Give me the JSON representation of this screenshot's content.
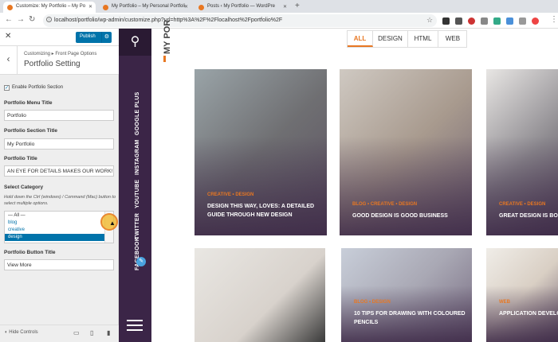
{
  "browser": {
    "tabs": [
      {
        "title": "Customize: My Portfolio – My Po"
      },
      {
        "title": "My Portfolio – My Personal Portfoli"
      },
      {
        "title": "Posts ‹ My Portfolio — WordPre"
      }
    ],
    "url": "localhost/portfolio/wp-admin/customize.php?url=http%3A%2F%2Flocalhost%2Fportfolio%2F"
  },
  "customizer": {
    "publish": "Publish",
    "breadcrumb": "Customizing ▸ Front Page Options",
    "title": "Portfolio Setting",
    "enable_label": "Enable Portfolio Section",
    "menu_title_label": "Portfolio Menu Title",
    "menu_title_value": "Portfolio",
    "section_title_label": "Portfolio Section Title",
    "section_title_value": "My Portfolio",
    "title_label": "Portfolio Title",
    "title_value": "AN EYE FOR DETAILS MAKES OUR WORK!",
    "category_label": "Select Category",
    "category_desc": "Hold down the Ctrl (windows) / Command (Mac) button to select multiple options.",
    "category_options": [
      "— All —",
      "blog",
      "creative",
      "design"
    ],
    "category_selected": "design",
    "button_title_label": "Portfolio Button Title",
    "button_title_value": "View More",
    "hide_controls": "Hide Controls"
  },
  "site": {
    "social": [
      "GOOGLE PLUS",
      "INSTAGRAM",
      "YOUTUBE",
      "TWITTER",
      "FACEBOOK"
    ],
    "section_title": "MY POR",
    "filters": [
      "ALL",
      "DESIGN",
      "HTML",
      "WEB"
    ],
    "active_filter": "ALL",
    "cards": [
      {
        "category": "CREATIVE • DESIGN",
        "title": "DESIGN THIS WAY, LOVES: A DETAILED GUIDE THROUGH NEW DESIGN"
      },
      {
        "category": "BLOG • CREATIVE • DESIGN",
        "title": "GOOD DESIGN IS GOOD BUSINESS"
      },
      {
        "category": "CREATIVE • DESIGN",
        "title": "GREAT DESIGN IS BORN O"
      },
      {
        "category": "",
        "title": ""
      },
      {
        "category": "BLOG • DESIGN",
        "title": "10 TIPS FOR DRAWING WITH COLOURED PENCILS"
      },
      {
        "category": "WEB",
        "title": "APPLICATION DEVELOPM"
      }
    ]
  },
  "colors": {
    "accent": "#e87722",
    "nav_bg": "#3b2547",
    "wp_blue": "#0073aa"
  }
}
